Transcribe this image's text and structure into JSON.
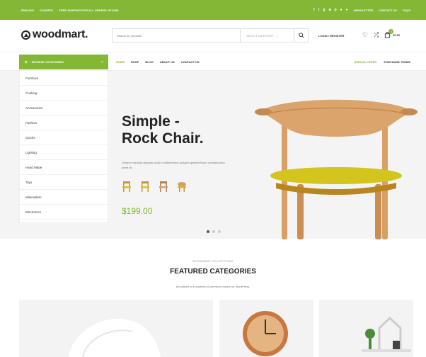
{
  "topbar": {
    "lang": "ENGLISH",
    "currency": "COUNTRY",
    "promo": "FREE SHIPPING FOR ALL ORDERS OF $150",
    "newsletter": "NEWSLETTER",
    "contact": "CONTACT US",
    "faqs": "FAQS"
  },
  "header": {
    "brand": "woodmart.",
    "search_placeholder": "Search for products",
    "category_select": "SELECT CATEGORY",
    "login": "LOGIN / REGISTER",
    "cart_count": "0",
    "cart_amount": "$0.00"
  },
  "nav": {
    "browse": "BROWSE CATEGORIES",
    "menu": [
      "HOME",
      "SHOP",
      "BLOG",
      "ABOUT US",
      "CONTACT US"
    ],
    "special": "SPECIAL OFFER",
    "purchase": "PURCHASE THEME"
  },
  "sidebar": {
    "items": [
      "Furniture",
      "Cooking",
      "Accessories",
      "Fashion",
      "Clocks",
      "Lighting",
      "Hand Made",
      "Toys",
      "Minimalism",
      "Electronics"
    ]
  },
  "hero": {
    "title_line1": "Simple -",
    "title_line2": "Rock Chair.",
    "description": "Semper volutpat aliquam curae condimentum quisque gravida fusce convallis arcu amet sit.",
    "price": "$199.00"
  },
  "collections": {
    "subtitle": "WOODMART COLLECTIONS",
    "title": "FEATURED CATEGORIES",
    "description": "WoodMart is a powerful eCommerce theme for WordPress."
  },
  "colors": {
    "accent": "#83b735",
    "seat": "#d4c41e",
    "wood": "#d9a066"
  }
}
